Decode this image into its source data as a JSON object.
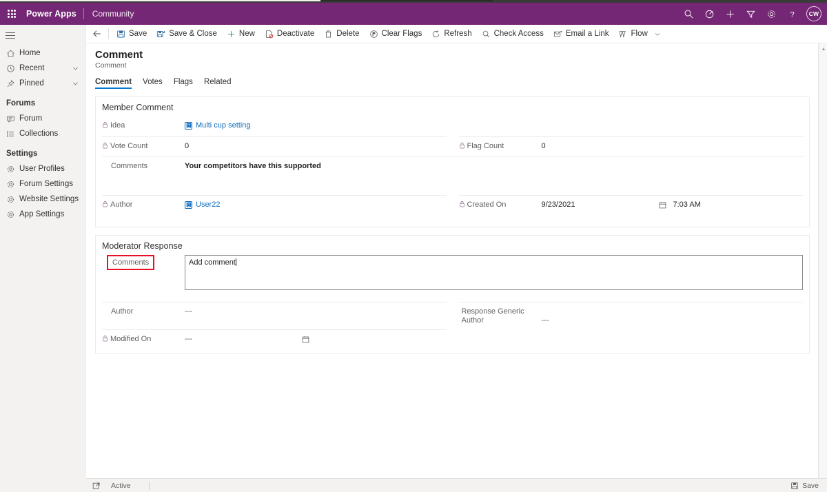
{
  "header": {
    "brand": "Power Apps",
    "environment": "Community",
    "icons": [
      "search-icon",
      "target-icon",
      "plus-icon",
      "filter-icon",
      "gear-icon",
      "help-icon"
    ],
    "avatar_initials": "CW",
    "brand_color": "#742774"
  },
  "sidebar": {
    "hamburger": "site-map-toggle",
    "primary": [
      {
        "label": "Home",
        "icon": "home-icon",
        "chevron": false
      },
      {
        "label": "Recent",
        "icon": "clock-icon",
        "chevron": true
      },
      {
        "label": "Pinned",
        "icon": "pin-icon",
        "chevron": true
      }
    ],
    "groups": [
      {
        "title": "Forums",
        "items": [
          {
            "label": "Forum",
            "icon": "forum-icon"
          },
          {
            "label": "Collections",
            "icon": "collections-icon"
          }
        ]
      },
      {
        "title": "Settings",
        "items": [
          {
            "label": "User Profiles",
            "icon": "gear-icon"
          },
          {
            "label": "Forum Settings",
            "icon": "gear-icon"
          },
          {
            "label": "Website Settings",
            "icon": "gear-icon"
          },
          {
            "label": "App Settings",
            "icon": "gear-icon"
          }
        ]
      }
    ]
  },
  "commandbar": {
    "back": "back-arrow",
    "buttons": [
      {
        "label": "Save",
        "icon": "save-icon"
      },
      {
        "label": "Save & Close",
        "icon": "save-close-icon"
      },
      {
        "label": "New",
        "icon": "plus-icon"
      },
      {
        "label": "Deactivate",
        "icon": "deactivate-icon"
      },
      {
        "label": "Delete",
        "icon": "trash-icon"
      },
      {
        "label": "Clear Flags",
        "icon": "clear-flags-icon"
      },
      {
        "label": "Refresh",
        "icon": "refresh-icon"
      },
      {
        "label": "Check Access",
        "icon": "check-access-icon"
      },
      {
        "label": "Email a Link",
        "icon": "email-link-icon"
      },
      {
        "label": "Flow",
        "icon": "flow-icon",
        "chevron": true
      }
    ]
  },
  "record": {
    "title": "Comment",
    "subtitle": "Comment"
  },
  "tabs": [
    {
      "label": "Comment",
      "active": true
    },
    {
      "label": "Votes",
      "active": false
    },
    {
      "label": "Flags",
      "active": false
    },
    {
      "label": "Related",
      "active": false
    }
  ],
  "member_comment": {
    "section_title": "Member Comment",
    "idea": {
      "label": "Idea",
      "locked": true,
      "value": "Multi cup setting",
      "type": "lookup"
    },
    "vote_count": {
      "label": "Vote Count",
      "locked": true,
      "value": "0"
    },
    "flag_count": {
      "label": "Flag Count",
      "locked": true,
      "value": "0"
    },
    "comments": {
      "label": "Comments",
      "locked": false,
      "value": "Your competitors have this supported"
    },
    "author": {
      "label": "Author",
      "locked": true,
      "value": "User22",
      "type": "lookup"
    },
    "created_on": {
      "label": "Created On",
      "locked": true,
      "date": "9/23/2021",
      "time": "7:03 AM"
    }
  },
  "moderator_response": {
    "section_title": "Moderator Response",
    "comments": {
      "label": "Comments",
      "value": "Add comment",
      "highlighted": true,
      "highlight_color": "#e81123"
    },
    "author": {
      "label": "Author",
      "locked": false,
      "value": "---"
    },
    "response_generic_author": {
      "label": "Response Generic Author",
      "locked": false,
      "value": "---"
    },
    "modified_on": {
      "label": "Modified On",
      "locked": true,
      "value": "---"
    }
  },
  "statusbar": {
    "state": "Active",
    "save_label": "Save",
    "save_icon": "save-icon",
    "state_icon": "popout-icon"
  }
}
